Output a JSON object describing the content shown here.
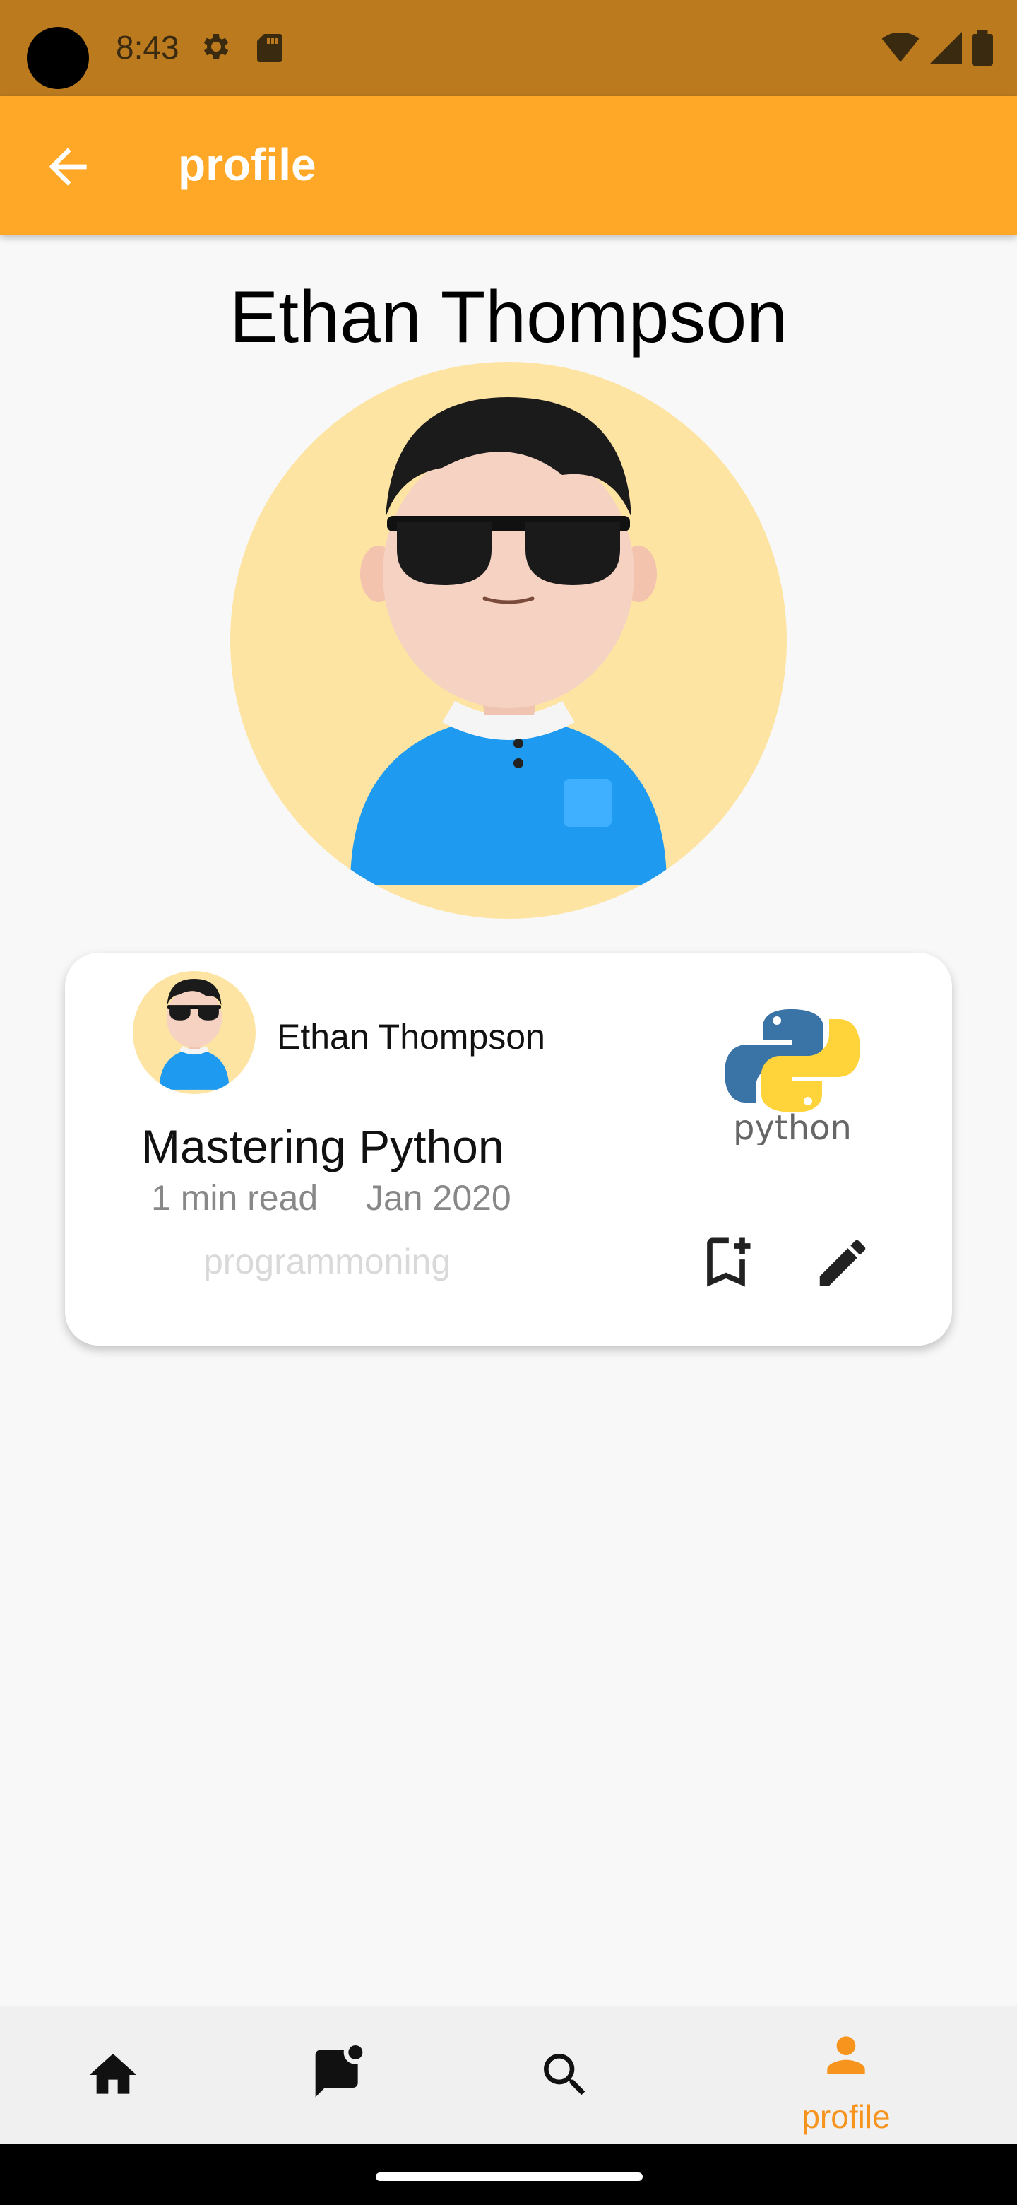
{
  "status_bar": {
    "time": "8:43"
  },
  "app_bar": {
    "title": "profile"
  },
  "profile": {
    "name": "Ethan Thompson"
  },
  "post_card": {
    "author": "Ethan Thompson",
    "title": "Mastering Python",
    "read_time": "1 min read",
    "date": "Jan 2020",
    "tag": "programmoning",
    "logo_text": "python"
  },
  "bottom_nav": {
    "items": [
      {
        "icon": "home-icon",
        "label": ""
      },
      {
        "icon": "chat-icon",
        "label": ""
      },
      {
        "icon": "search-icon",
        "label": ""
      },
      {
        "icon": "person-icon",
        "label": "profile"
      }
    ],
    "active_index": 3
  },
  "colors": {
    "status_bar": "#bb7a1e",
    "app_bar": "#ffa726",
    "accent": "#f7941d",
    "avatar_bg": "#fee4a3"
  }
}
